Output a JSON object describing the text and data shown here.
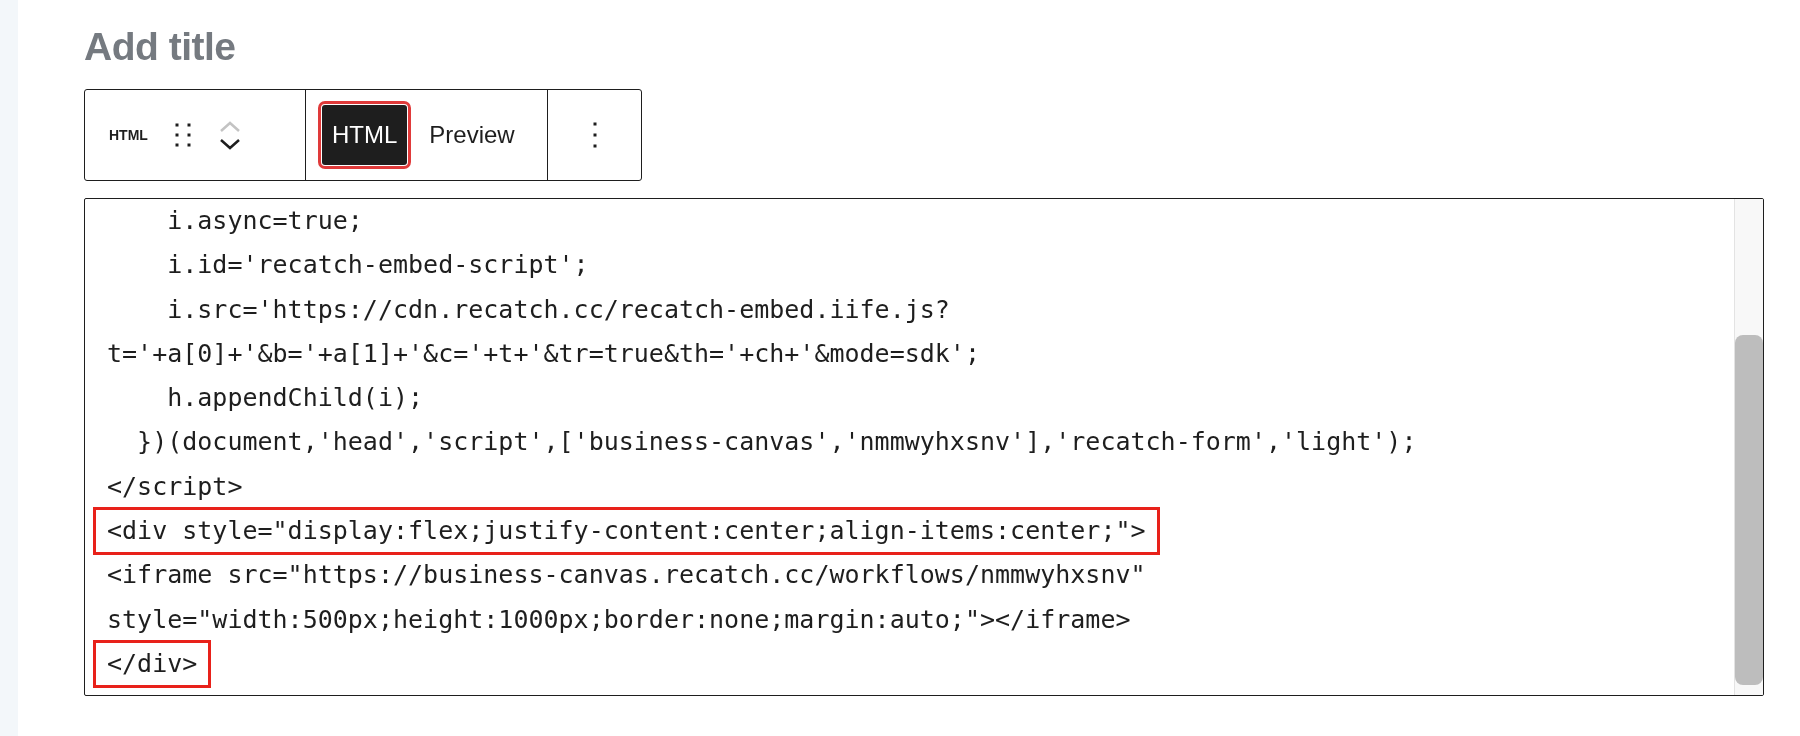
{
  "title_placeholder": "Add title",
  "toolbar": {
    "block_label": "HTML",
    "move_buttons": [
      {
        "kind": "up",
        "disabled": true
      },
      {
        "kind": "down",
        "disabled": false
      }
    ],
    "tabs": [
      {
        "label": "HTML",
        "selected": true,
        "highlighted": true
      },
      {
        "label": "Preview",
        "selected": false,
        "highlighted": false
      }
    ]
  },
  "code_lines": [
    {
      "text": "    i.async=true;",
      "highlighted": false
    },
    {
      "text": "    i.id='recatch-embed-script';",
      "highlighted": false
    },
    {
      "text": "    i.src='https://cdn.recatch.cc/recatch-embed.iife.js?",
      "highlighted": false
    },
    {
      "text": "t='+a[0]+'&b='+a[1]+'&c='+t+'&tr=true&th='+ch+'&mode=sdk';",
      "highlighted": false
    },
    {
      "text": "    h.appendChild(i);",
      "highlighted": false
    },
    {
      "text": "  })(document,'head','script',['business-canvas','nmmwyhxsnv'],'recatch-form','light');",
      "highlighted": false
    },
    {
      "text": "</script>",
      "highlighted": false
    },
    {
      "text": "<div style=\"display:flex;justify-content:center;align-items:center;\">",
      "highlighted": true
    },
    {
      "text": "<iframe src=\"https://business-canvas.recatch.cc/workflows/nmmwyhxsnv\"",
      "highlighted": false
    },
    {
      "text": "style=\"width:500px;height:1000px;border:none;margin:auto;\"></iframe>",
      "highlighted": false
    },
    {
      "text": "</div>",
      "highlighted": true
    }
  ]
}
